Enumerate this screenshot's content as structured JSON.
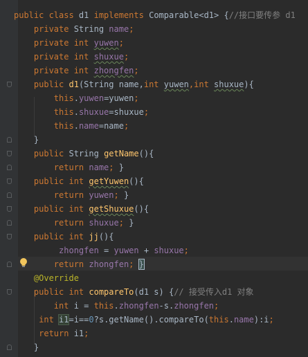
{
  "editor": {
    "colors": {
      "background": "#2b2b2b",
      "gutter": "#313335",
      "keyword": "#cc7832",
      "field": "#9876aa",
      "method": "#ffc66d",
      "comment": "#808080",
      "annotation": "#bbb529",
      "number": "#6897bb",
      "text": "#a9b7c6"
    },
    "gutter_icons": [
      "fold-icon",
      "lightbulb-icon"
    ],
    "lines": [
      [
        {
          "t": "public class ",
          "c": "kw"
        },
        {
          "t": "d1 ",
          "c": ""
        },
        {
          "t": "implements ",
          "c": "kw"
        },
        {
          "t": "Comparable<d1> {",
          "c": ""
        },
        {
          "t": "//接口要传参 d1",
          "c": "cm"
        }
      ],
      [
        {
          "t": "    private ",
          "c": "kw"
        },
        {
          "t": "String ",
          "c": ""
        },
        {
          "t": "name",
          "c": "fld"
        },
        {
          "t": ";",
          "c": "kw"
        }
      ],
      [
        {
          "t": "    private int ",
          "c": "kw"
        },
        {
          "t": "yuwen",
          "c": "fld squig"
        },
        {
          "t": ";",
          "c": "kw"
        }
      ],
      [
        {
          "t": "    private int ",
          "c": "kw"
        },
        {
          "t": "shuxue",
          "c": "fld squig"
        },
        {
          "t": ";",
          "c": "kw"
        }
      ],
      [
        {
          "t": "    private int ",
          "c": "kw"
        },
        {
          "t": "zhongfen",
          "c": "fld squig"
        },
        {
          "t": ";",
          "c": "kw"
        }
      ],
      [
        {
          "t": "    public ",
          "c": "kw"
        },
        {
          "t": "d1",
          "c": "fn"
        },
        {
          "t": "(String name,",
          "c": ""
        },
        {
          "t": "int ",
          "c": "kw"
        },
        {
          "t": "yuwen",
          "c": "squig"
        },
        {
          "t": ",",
          "c": "kw"
        },
        {
          "t": "int ",
          "c": "kw"
        },
        {
          "t": "shuxue",
          "c": "squig"
        },
        {
          "t": "){",
          "c": ""
        }
      ],
      [
        {
          "t": "        this",
          "c": "kw"
        },
        {
          "t": ".",
          "c": ""
        },
        {
          "t": "yuwen",
          "c": "fld"
        },
        {
          "t": "=yuwen",
          "c": ""
        },
        {
          "t": ";",
          "c": "kw"
        }
      ],
      [
        {
          "t": "        this",
          "c": "kw"
        },
        {
          "t": ".",
          "c": ""
        },
        {
          "t": "shuxue",
          "c": "fld"
        },
        {
          "t": "=shuxue",
          "c": ""
        },
        {
          "t": ";",
          "c": "kw"
        }
      ],
      [
        {
          "t": "        this",
          "c": "kw"
        },
        {
          "t": ".",
          "c": ""
        },
        {
          "t": "name",
          "c": "fld"
        },
        {
          "t": "=name",
          "c": ""
        },
        {
          "t": ";",
          "c": "kw"
        }
      ],
      [
        {
          "t": "    }",
          "c": ""
        }
      ],
      [
        {
          "t": "    public ",
          "c": "kw"
        },
        {
          "t": "String ",
          "c": ""
        },
        {
          "t": "getName",
          "c": "fn"
        },
        {
          "t": "(){",
          "c": ""
        }
      ],
      [
        {
          "t": "        return ",
          "c": "kw"
        },
        {
          "t": "name",
          "c": "fld"
        },
        {
          "t": "; ",
          "c": "kw"
        },
        {
          "t": "}",
          "c": ""
        }
      ],
      [
        {
          "t": "    public int ",
          "c": "kw"
        },
        {
          "t": "getYuwen",
          "c": "fn squig"
        },
        {
          "t": "(){",
          "c": ""
        }
      ],
      [
        {
          "t": "        return ",
          "c": "kw"
        },
        {
          "t": "yuwen",
          "c": "fld"
        },
        {
          "t": "; ",
          "c": "kw"
        },
        {
          "t": "}",
          "c": ""
        }
      ],
      [
        {
          "t": "    public int ",
          "c": "kw"
        },
        {
          "t": "getShuxue",
          "c": "fn squig"
        },
        {
          "t": "(){",
          "c": ""
        }
      ],
      [
        {
          "t": "        return ",
          "c": "kw"
        },
        {
          "t": "shuxue",
          "c": "fld"
        },
        {
          "t": "; ",
          "c": "kw"
        },
        {
          "t": "}",
          "c": ""
        }
      ],
      [
        {
          "t": "    public int ",
          "c": "kw"
        },
        {
          "t": "jj",
          "c": "fn"
        },
        {
          "t": "(){",
          "c": ""
        }
      ],
      [
        {
          "t": "         zhongfen ",
          "c": "fld"
        },
        {
          "t": "= ",
          "c": ""
        },
        {
          "t": "yuwen ",
          "c": "fld"
        },
        {
          "t": "+ ",
          "c": ""
        },
        {
          "t": "shuxue",
          "c": "fld"
        },
        {
          "t": ";",
          "c": "kw"
        }
      ],
      [
        {
          "t": "        return ",
          "c": "kw"
        },
        {
          "t": "zhongfen",
          "c": "fld"
        },
        {
          "t": "; ",
          "c": "kw"
        },
        {
          "t": "}",
          "c": "caret-brace"
        }
      ],
      [
        {
          "t": "    @Override",
          "c": "ann"
        }
      ],
      [
        {
          "t": "    public int ",
          "c": "kw"
        },
        {
          "t": "compareTo",
          "c": "fn"
        },
        {
          "t": "(d1 s) {",
          "c": ""
        },
        {
          "t": "// 接受传入d1 对象",
          "c": "cm"
        }
      ],
      [
        {
          "t": "        int ",
          "c": "kw"
        },
        {
          "t": "i = ",
          "c": ""
        },
        {
          "t": "this",
          "c": "kw"
        },
        {
          "t": ".",
          "c": ""
        },
        {
          "t": "zhongfen",
          "c": "fld"
        },
        {
          "t": "-s.",
          "c": ""
        },
        {
          "t": "zhongfen",
          "c": "fld"
        },
        {
          "t": ";",
          "c": "kw"
        }
      ],
      [
        {
          "t": "     int ",
          "c": "kw"
        },
        {
          "t": "i1",
          "c": "ident-highlight"
        },
        {
          "t": "=i==",
          "c": ""
        },
        {
          "t": "0",
          "c": "num"
        },
        {
          "t": "?s.getName().compareTo(",
          "c": ""
        },
        {
          "t": "this",
          "c": "kw"
        },
        {
          "t": ".",
          "c": ""
        },
        {
          "t": "name",
          "c": "fld"
        },
        {
          "t": "):i",
          "c": ""
        },
        {
          "t": ";",
          "c": "kw"
        }
      ],
      [
        {
          "t": "     return ",
          "c": "kw"
        },
        {
          "t": "i1",
          "c": ""
        },
        {
          "t": ";",
          "c": "kw"
        }
      ],
      [
        {
          "t": "    }",
          "c": ""
        }
      ]
    ]
  }
}
